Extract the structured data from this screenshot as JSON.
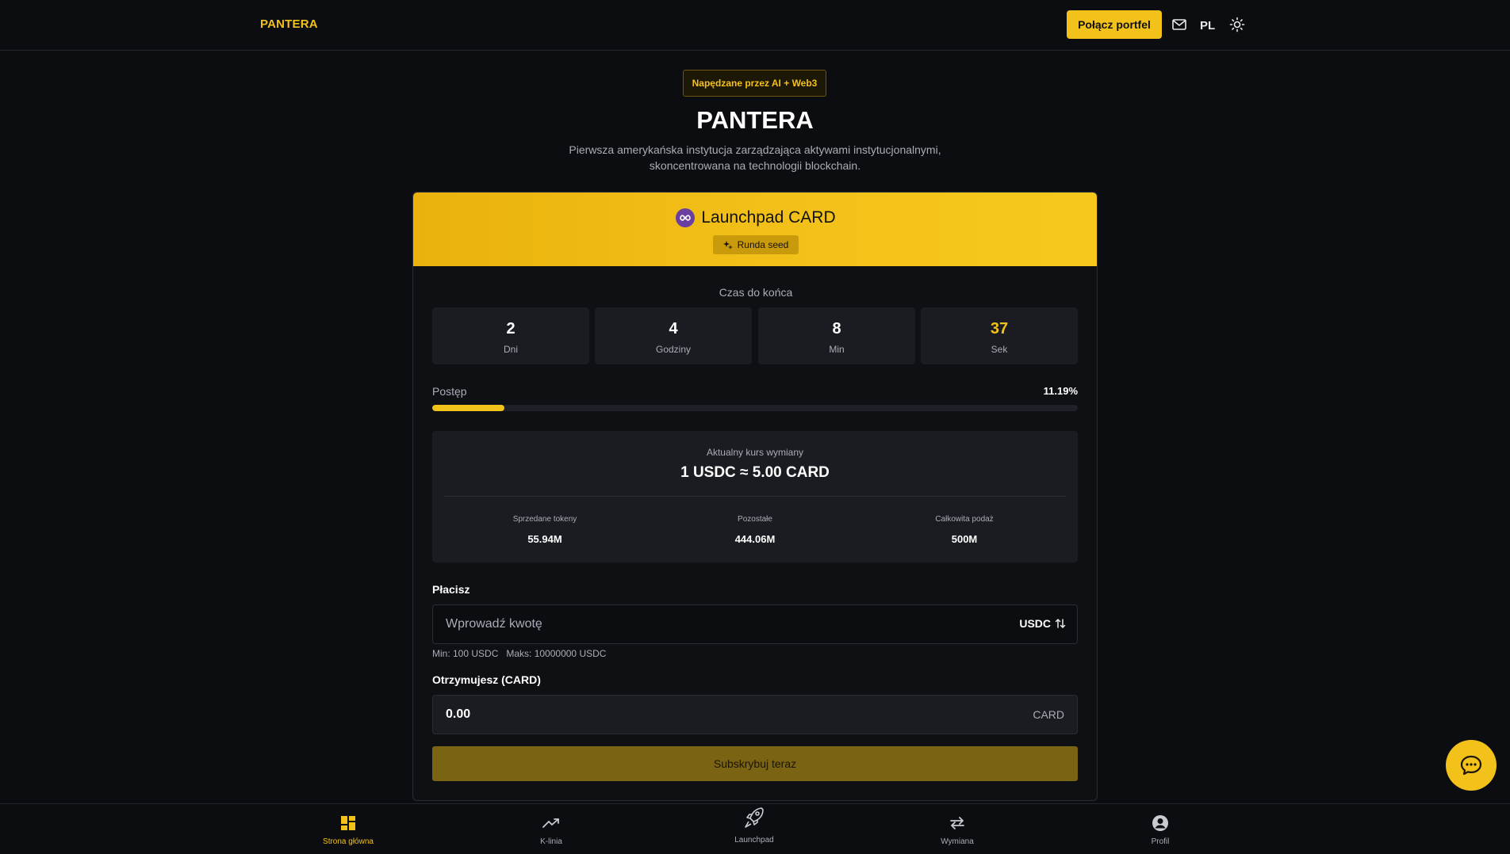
{
  "header": {
    "logo": "PANTERA",
    "connect_label": "Połącz portfel",
    "language": "PL"
  },
  "hero": {
    "badge": "Napędzane przez AI + Web3",
    "title": "PANTERA",
    "subtitle": "Pierwsza amerykańska instytucja zarządzająca aktywami instytucjonalnymi, skoncentrowana na technologii blockchain."
  },
  "card": {
    "title": "Launchpad CARD",
    "round": "Runda seed",
    "countdown_label": "Czas do końca",
    "countdown": [
      {
        "value": "2",
        "unit": "Dni"
      },
      {
        "value": "4",
        "unit": "Godziny"
      },
      {
        "value": "8",
        "unit": "Min"
      },
      {
        "value": "37",
        "unit": "Sek"
      }
    ],
    "progress_label": "Postęp",
    "progress_text": "11.19%",
    "progress_fraction": 0.1119,
    "rate_label": "Aktualny kurs wymiany",
    "rate_value": "1 USDC ≈ 5.00 CARD",
    "stats": [
      {
        "label": "Sprzedane tokeny",
        "value": "55.94M"
      },
      {
        "label": "Pozostałe",
        "value": "444.06M"
      },
      {
        "label": "Całkowita podaż",
        "value": "500M"
      }
    ],
    "pay_label": "Płacisz",
    "pay_placeholder": "Wprowadź kwotę",
    "pay_currency": "USDC",
    "min_limit": "Min: 100 USDC",
    "max_limit": "Maks: 10000000 USDC",
    "receive_label": "Otrzymujesz (CARD)",
    "receive_value": "0.00",
    "receive_unit": "CARD",
    "subscribe_label": "Subskrybuj teraz"
  },
  "bottom_nav": [
    {
      "label": "Strona główna",
      "icon": "dashboard-icon",
      "active": true
    },
    {
      "label": "K-linia",
      "icon": "trend-icon",
      "active": false
    },
    {
      "label": "Launchpad",
      "icon": "rocket-icon",
      "active": false
    },
    {
      "label": "Wymiana",
      "icon": "swap-icon",
      "active": false
    },
    {
      "label": "Profil",
      "icon": "profile-icon",
      "active": false
    }
  ],
  "colors": {
    "accent": "#f3c21a",
    "background": "#0c0d10",
    "panel": "#1a1c22",
    "subscribe_disabled": "#7a6312"
  }
}
